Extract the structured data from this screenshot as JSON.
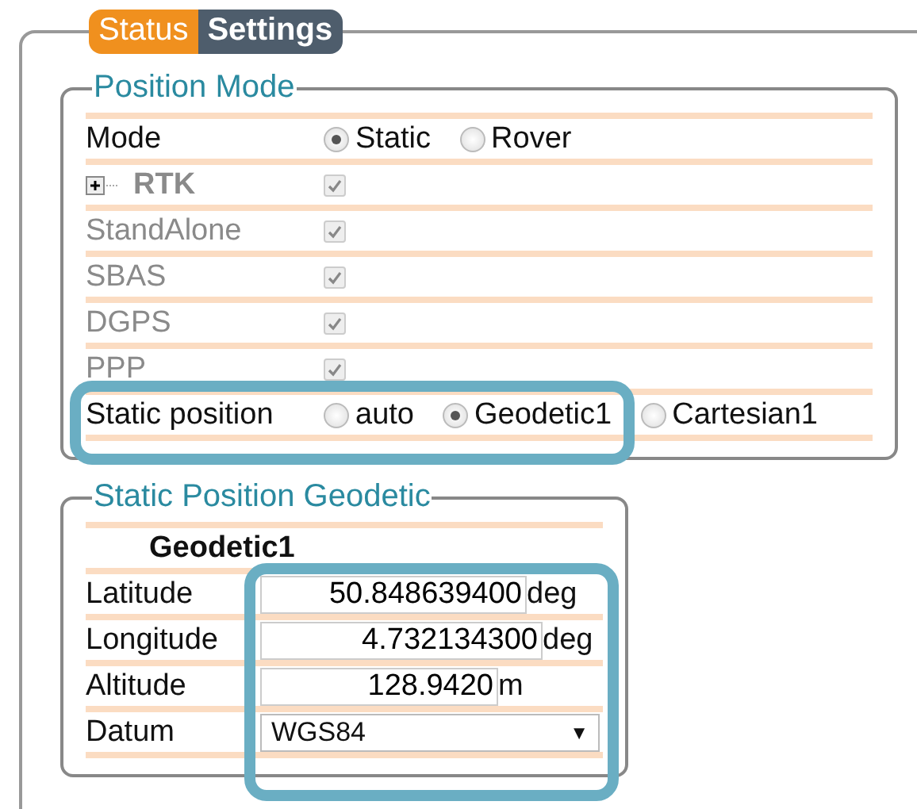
{
  "tabs": [
    {
      "label": "Status",
      "selected": false
    },
    {
      "label": "Settings",
      "selected": true
    }
  ],
  "position_mode": {
    "title": "Position Mode",
    "rows": [
      {
        "kind": "radio",
        "label": "Mode",
        "disabled": false,
        "highlighted": false,
        "options": [
          {
            "label": "Static",
            "selected": true
          },
          {
            "label": "Rover",
            "selected": false
          }
        ]
      },
      {
        "kind": "check",
        "label": "RTK",
        "expandable": true,
        "disabled": true,
        "checked": true,
        "highlighted": false
      },
      {
        "kind": "check",
        "label": "StandAlone",
        "disabled": true,
        "checked": true,
        "highlighted": false
      },
      {
        "kind": "check",
        "label": "SBAS",
        "disabled": true,
        "checked": true,
        "highlighted": false
      },
      {
        "kind": "check",
        "label": "DGPS",
        "disabled": true,
        "checked": true,
        "highlighted": false
      },
      {
        "kind": "check",
        "label": "PPP",
        "disabled": true,
        "checked": true,
        "highlighted": false
      },
      {
        "kind": "radio",
        "label": "Static position",
        "disabled": false,
        "highlighted": true,
        "options": [
          {
            "label": "auto",
            "selected": false
          },
          {
            "label": "Geodetic1",
            "selected": true
          },
          {
            "label": "Cartesian1",
            "selected": false
          }
        ]
      }
    ]
  },
  "static_position": {
    "title": "Static Position Geodetic",
    "heading": "Geodetic1",
    "fields_highlighted": true,
    "rows": [
      {
        "kind": "input",
        "label": "Latitude",
        "value": "50.848639400",
        "unit": "deg"
      },
      {
        "kind": "input",
        "label": "Longitude",
        "value": "4.732134300",
        "unit": "deg"
      },
      {
        "kind": "input",
        "label": "Altitude",
        "value": "128.9420",
        "unit": "m"
      },
      {
        "kind": "select",
        "label": "Datum",
        "value": "WGS84",
        "arrow": "▼"
      }
    ]
  }
}
